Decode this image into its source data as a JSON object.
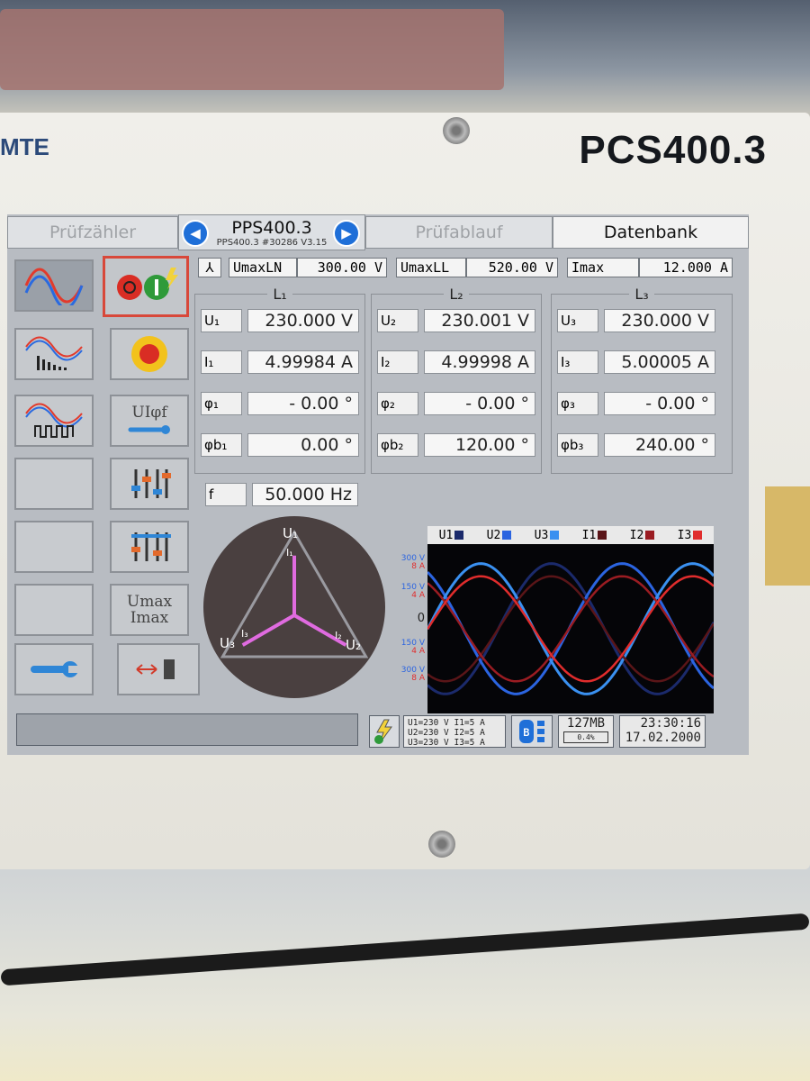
{
  "device": {
    "brand": "MTE",
    "model": "PCS400.3"
  },
  "tabs": {
    "left": "Prüfzähler",
    "center_title": "PPS400.3",
    "center_subtitle": "PPS400.3 #30286 V3.15",
    "right1": "Prüfablauf",
    "right2": "Datenbank"
  },
  "left_buttons": {
    "uiphif": "UIφf",
    "umax_line1": "Umax",
    "umax_line2": "Imax"
  },
  "limits": {
    "umax_ln_label": "UmaxLN",
    "umax_ln_value": "300.00 V",
    "umax_ll_label": "UmaxLL",
    "umax_ll_value": "520.00 V",
    "imax_label": "Imax",
    "imax_value": "12.000 A"
  },
  "phases": [
    {
      "title": "L₁",
      "u_label": "U₁",
      "u_value": "230.000  V",
      "i_label": "I₁",
      "i_value": "4.99984  A",
      "phi_label": "φ₁",
      "phi_value": "-  0.00  °",
      "phib_label": "φb₁",
      "phib_value": "0.00  °"
    },
    {
      "title": "L₂",
      "u_label": "U₂",
      "u_value": "230.001  V",
      "i_label": "I₂",
      "i_value": "4.99998  A",
      "phi_label": "φ₂",
      "phi_value": "-  0.00  °",
      "phib_label": "φb₂",
      "phib_value": "120.00  °"
    },
    {
      "title": "L₃",
      "u_label": "U₃",
      "u_value": "230.000  V",
      "i_label": "I₃",
      "i_value": "5.00005  A",
      "phi_label": "φ₃",
      "phi_value": "-  0.00  °",
      "phib_label": "φb₃",
      "phib_value": "240.00  °"
    }
  ],
  "frequency": {
    "label": "f",
    "value": "50.000  Hz"
  },
  "phasor": {
    "u1": "U₁",
    "u2": "U₂",
    "u3": "U₃",
    "i1": "I₁",
    "i2": "I₂",
    "i3": "I₃",
    "angles_deg": [
      90,
      -30,
      210
    ]
  },
  "waveform": {
    "legend": [
      "U1",
      "U2",
      "U3",
      "I1",
      "I2",
      "I3"
    ],
    "legend_colors": [
      "#1b2a6b",
      "#2b64e0",
      "#3a90f0",
      "#5a1518",
      "#9a1c22",
      "#e02c2c"
    ],
    "axis_labels": [
      {
        "v": "300 V",
        "i": "8 A"
      },
      {
        "v": "150 V",
        "i": "4 A"
      },
      {
        "v": "0",
        "i": ""
      },
      {
        "v": "150 V",
        "i": "4 A"
      },
      {
        "v": "300 V",
        "i": "8 A"
      }
    ],
    "phase_shift_deg": [
      0,
      120,
      240
    ],
    "u_amplitude_rel": 0.77,
    "i_amplitude_rel": 0.62
  },
  "status": {
    "source_lines": [
      "U1=230 V  I1=5 A",
      "U2=230 V  I2=5 A",
      "U3=230 V  I3=5 A"
    ],
    "memory": "127MB",
    "memory_pct": "0.4%",
    "time": "23:30:16",
    "date": "17.02.2000"
  }
}
